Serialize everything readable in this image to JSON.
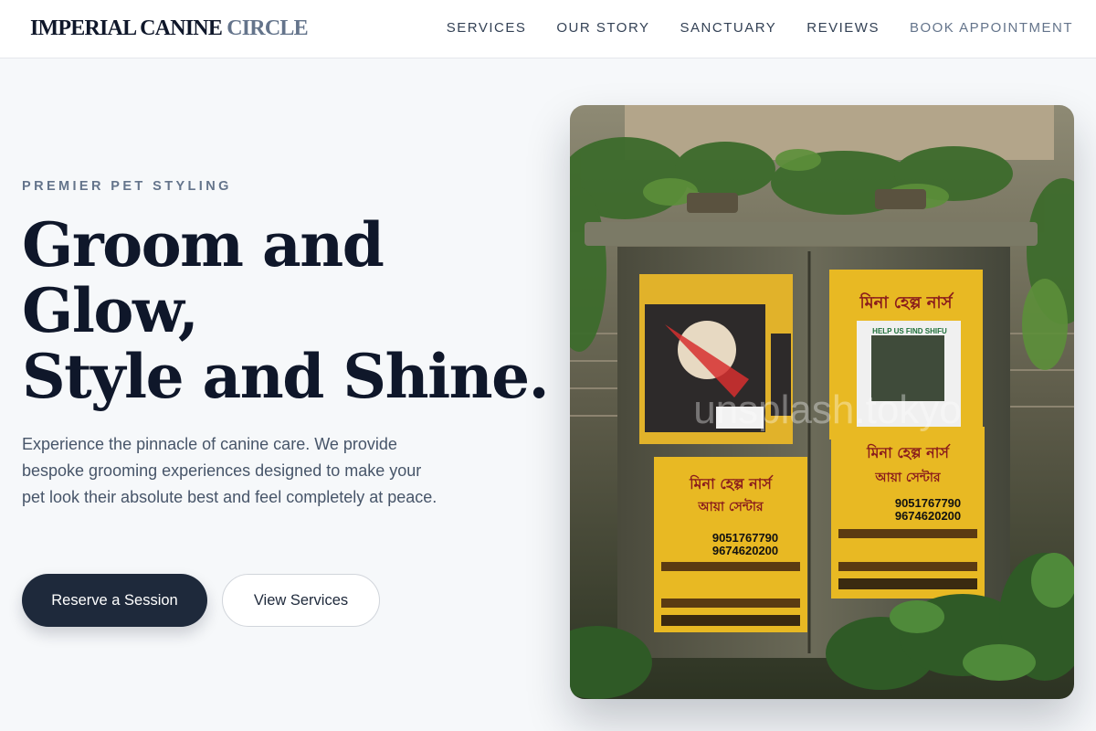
{
  "header": {
    "brand_primary": "IMPERIAL CANINE",
    "brand_accent": "CIRCLE",
    "nav": [
      {
        "label": "SERVICES"
      },
      {
        "label": "OUR STORY"
      },
      {
        "label": "SANCTUARY"
      },
      {
        "label": "REVIEWS"
      },
      {
        "label": "BOOK APPOINTMENT"
      }
    ]
  },
  "hero": {
    "eyebrow": "PREMIER PET STYLING",
    "headline": [
      "Groom and",
      "Glow,",
      "Style and Shine."
    ],
    "description": "Experience the pinnacle of canine care. We provide bespoke grooming experiences designed to make your pet look their absolute best and feel completely at peace.",
    "primary_cta": "Reserve a Session",
    "secondary_cta": "View Services",
    "photo": {
      "watermark": "unsplash.tokyo",
      "posters": [
        {
          "title": "মিনা হেল্প নার্স",
          "subtitle": "আয়া সেন্টার",
          "phone1": "9051767790",
          "phone2": "9674620200"
        },
        {
          "title": "মিনা হেল্প নার্স",
          "subtitle": "আয়া সেন্টার",
          "phone1": "9051767790",
          "phone2": "9674620200"
        },
        {
          "title": "মিনা হেল্প নার্স",
          "subtitle": "",
          "phone1": "",
          "phone2": ""
        }
      ],
      "notice_title": "HELP US FIND SHIFU"
    }
  },
  "colors": {
    "brand_dark": "#0f172a",
    "brand_accent": "#64748b",
    "button_primary": "#1e293b",
    "background": "#f6f8fa",
    "poster_yellow": "#e8b923"
  }
}
